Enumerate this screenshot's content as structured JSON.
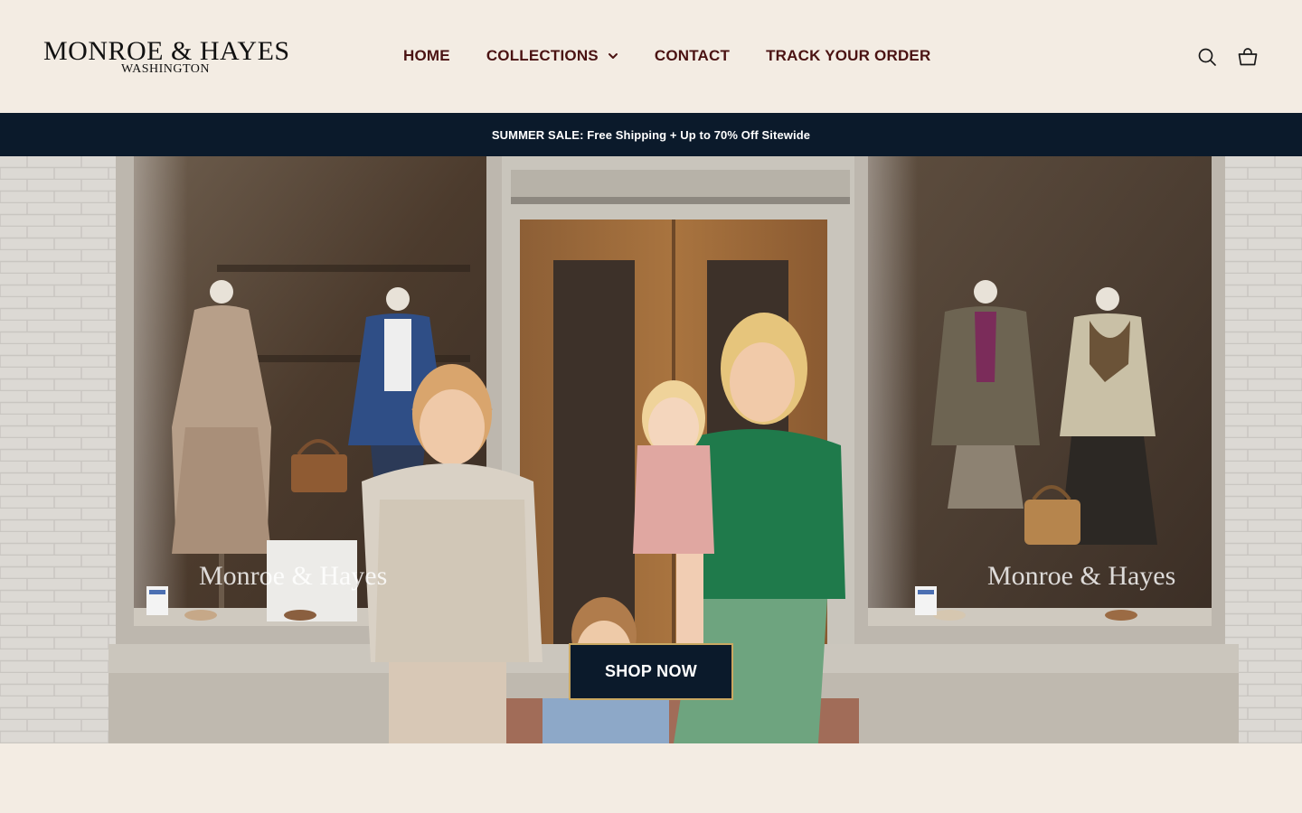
{
  "brand": {
    "name": "MONROE & HAYES",
    "location": "WASHINGTON"
  },
  "nav": {
    "items": [
      {
        "label": "HOME",
        "has_dropdown": false
      },
      {
        "label": "COLLECTIONS",
        "has_dropdown": true
      },
      {
        "label": "CONTACT",
        "has_dropdown": false
      },
      {
        "label": "TRACK YOUR ORDER",
        "has_dropdown": false
      }
    ]
  },
  "header_icons": {
    "search": "search-icon",
    "cart": "cart-icon"
  },
  "announcement": {
    "text": "SUMMER SALE: Free Shipping + Up to 70% Off Sitewide"
  },
  "hero": {
    "window_sign_left": "Monroe & Hayes",
    "window_sign_right": "Monroe & Hayes",
    "cta_label": "SHOP NOW"
  },
  "colors": {
    "page_background": "#f3ece3",
    "nav_text": "#4a1212",
    "announcement_bg": "#0b1a2b",
    "cta_bg": "#0b1a2b",
    "cta_border": "#c9a862"
  }
}
